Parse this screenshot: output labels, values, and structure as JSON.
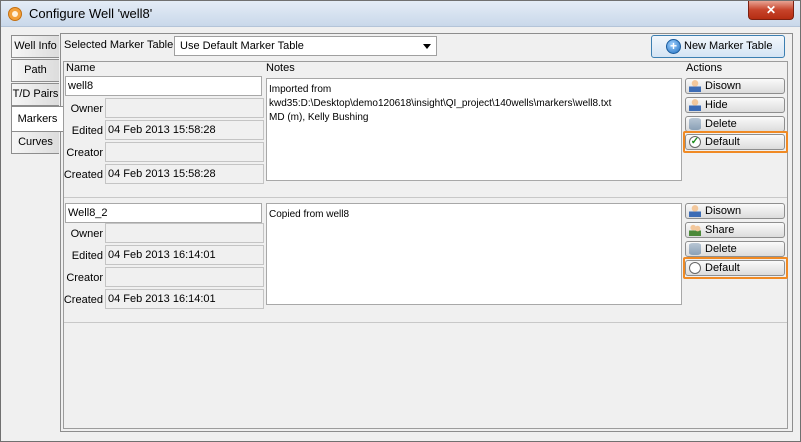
{
  "window": {
    "title": "Configure Well 'well8'",
    "close_glyph": "✕"
  },
  "tabs": [
    {
      "label": "Well Info"
    },
    {
      "label": "Path"
    },
    {
      "label": "T/D Pairs"
    },
    {
      "label": "Markers"
    },
    {
      "label": "Curves"
    }
  ],
  "selected_tab": "Markers",
  "marker_table": {
    "label": "Selected Marker Table",
    "value": "Use Default Marker Table",
    "new_button": "New Marker Table"
  },
  "columns": {
    "name": "Name",
    "notes": "Notes",
    "actions": "Actions"
  },
  "labels": {
    "owner": "Owner",
    "edited": "Edited",
    "creator": "Creator",
    "created": "Created"
  },
  "rows": [
    {
      "name": "well8",
      "owner": "",
      "edited": "04 Feb 2013   15:58:28",
      "creator": "",
      "created": "04 Feb 2013   15:58:28",
      "notes": [
        "Imported from",
        "kwd35:D:\\Desktop\\demo120618\\insight\\QI_project\\140wells\\markers\\well8.txt",
        "MD (m), Kelly Bushing"
      ],
      "actions": {
        "a1": "Disown",
        "a2": "Hide",
        "a3": "Delete",
        "a4": "Default"
      },
      "default_selected": true
    },
    {
      "name": "Well8_2",
      "owner": "",
      "edited": "04 Feb 2013   16:14:01",
      "creator": "",
      "created": "04 Feb 2013   16:14:01",
      "notes": [
        "Copied from well8"
      ],
      "actions": {
        "a1": "Disown",
        "a2": "Share",
        "a3": "Delete",
        "a4": "Default"
      },
      "default_selected": false
    }
  ],
  "colors": {
    "highlight": "#f08a24",
    "accent": "#3c7fb1"
  },
  "icons": {
    "disown": "user-icon",
    "hide": "user-icon",
    "share": "users-icon",
    "delete": "database-icon",
    "default_on": "check-radio-icon",
    "default_off": "radio-icon",
    "new": "plus-circle-icon"
  }
}
